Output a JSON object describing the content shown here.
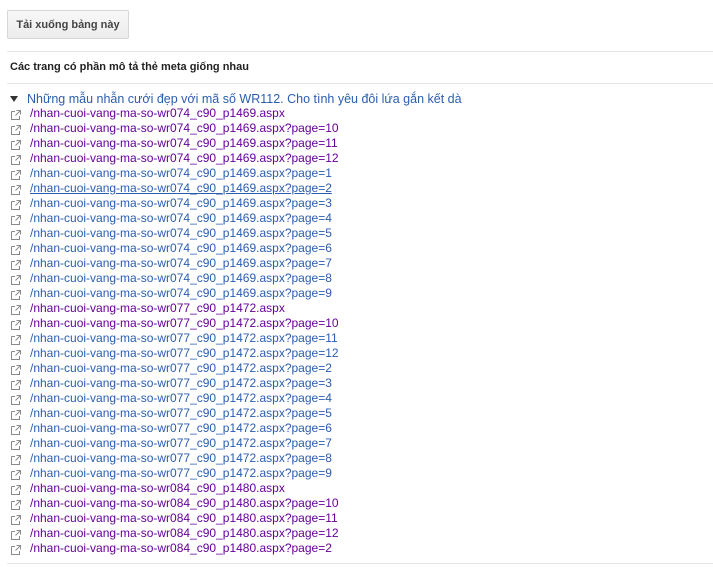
{
  "toolbar": {
    "download_label": "Tải xuống bảng này"
  },
  "section": {
    "heading": "Các trang có phần mô tả thẻ meta giống nhau"
  },
  "group": {
    "title": "Những mẫu nhẫn cưới đẹp với mã số WR112. Cho tình yêu đôi lứa gắn kết dà"
  },
  "colors": {
    "link": "#2a5db0",
    "visited": "#660099"
  },
  "urls": [
    {
      "text": "/nhan-cuoi-vang-ma-so-wr074_c90_p1469.aspx",
      "state": "visited"
    },
    {
      "text": "/nhan-cuoi-vang-ma-so-wr074_c90_p1469.aspx?page=10",
      "state": "visited"
    },
    {
      "text": "/nhan-cuoi-vang-ma-so-wr074_c90_p1469.aspx?page=11",
      "state": "visited"
    },
    {
      "text": "/nhan-cuoi-vang-ma-so-wr074_c90_p1469.aspx?page=12",
      "state": "visited"
    },
    {
      "text": "/nhan-cuoi-vang-ma-so-wr074_c90_p1469.aspx?page=1",
      "state": "link"
    },
    {
      "text": "/nhan-cuoi-vang-ma-so-wr074_c90_p1469.aspx?page=2",
      "state": "hover"
    },
    {
      "text": "/nhan-cuoi-vang-ma-so-wr074_c90_p1469.aspx?page=3",
      "state": "link"
    },
    {
      "text": "/nhan-cuoi-vang-ma-so-wr074_c90_p1469.aspx?page=4",
      "state": "link"
    },
    {
      "text": "/nhan-cuoi-vang-ma-so-wr074_c90_p1469.aspx?page=5",
      "state": "link"
    },
    {
      "text": "/nhan-cuoi-vang-ma-so-wr074_c90_p1469.aspx?page=6",
      "state": "link"
    },
    {
      "text": "/nhan-cuoi-vang-ma-so-wr074_c90_p1469.aspx?page=7",
      "state": "link"
    },
    {
      "text": "/nhan-cuoi-vang-ma-so-wr074_c90_p1469.aspx?page=8",
      "state": "link"
    },
    {
      "text": "/nhan-cuoi-vang-ma-so-wr074_c90_p1469.aspx?page=9",
      "state": "link"
    },
    {
      "text": "/nhan-cuoi-vang-ma-so-wr077_c90_p1472.aspx",
      "state": "visited"
    },
    {
      "text": "/nhan-cuoi-vang-ma-so-wr077_c90_p1472.aspx?page=10",
      "state": "visited"
    },
    {
      "text": "/nhan-cuoi-vang-ma-so-wr077_c90_p1472.aspx?page=11",
      "state": "link"
    },
    {
      "text": "/nhan-cuoi-vang-ma-so-wr077_c90_p1472.aspx?page=12",
      "state": "link"
    },
    {
      "text": "/nhan-cuoi-vang-ma-so-wr077_c90_p1472.aspx?page=2",
      "state": "link"
    },
    {
      "text": "/nhan-cuoi-vang-ma-so-wr077_c90_p1472.aspx?page=3",
      "state": "link"
    },
    {
      "text": "/nhan-cuoi-vang-ma-so-wr077_c90_p1472.aspx?page=4",
      "state": "link"
    },
    {
      "text": "/nhan-cuoi-vang-ma-so-wr077_c90_p1472.aspx?page=5",
      "state": "link"
    },
    {
      "text": "/nhan-cuoi-vang-ma-so-wr077_c90_p1472.aspx?page=6",
      "state": "link"
    },
    {
      "text": "/nhan-cuoi-vang-ma-so-wr077_c90_p1472.aspx?page=7",
      "state": "link"
    },
    {
      "text": "/nhan-cuoi-vang-ma-so-wr077_c90_p1472.aspx?page=8",
      "state": "link"
    },
    {
      "text": "/nhan-cuoi-vang-ma-so-wr077_c90_p1472.aspx?page=9",
      "state": "link"
    },
    {
      "text": "/nhan-cuoi-vang-ma-so-wr084_c90_p1480.aspx",
      "state": "visited"
    },
    {
      "text": "/nhan-cuoi-vang-ma-so-wr084_c90_p1480.aspx?page=10",
      "state": "visited"
    },
    {
      "text": "/nhan-cuoi-vang-ma-so-wr084_c90_p1480.aspx?page=11",
      "state": "visited"
    },
    {
      "text": "/nhan-cuoi-vang-ma-so-wr084_c90_p1480.aspx?page=12",
      "state": "visited"
    },
    {
      "text": "/nhan-cuoi-vang-ma-so-wr084_c90_p1480.aspx?page=2",
      "state": "visited"
    }
  ]
}
